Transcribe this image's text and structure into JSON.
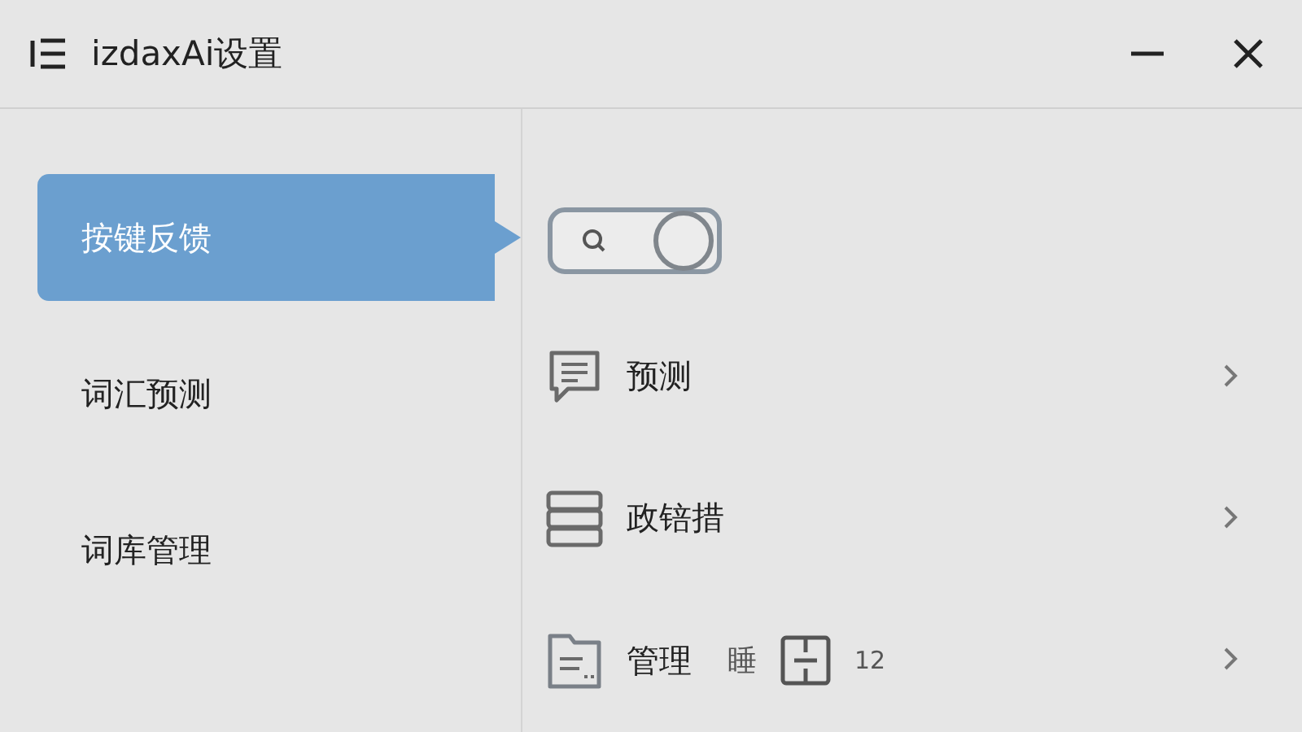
{
  "window": {
    "title": "izdaxAi设置"
  },
  "sidebar": {
    "items": [
      {
        "label": "按键反馈",
        "selected": true
      },
      {
        "label": "词汇预测",
        "selected": false
      },
      {
        "label": "词库管理",
        "selected": false
      }
    ]
  },
  "toggle": {
    "on": true
  },
  "rows": [
    {
      "kind": "chat",
      "label": "预测"
    },
    {
      "kind": "stack",
      "label": "政锫措"
    },
    {
      "kind": "folder",
      "label": "管理",
      "extra": "睡",
      "badge": "12"
    }
  ]
}
